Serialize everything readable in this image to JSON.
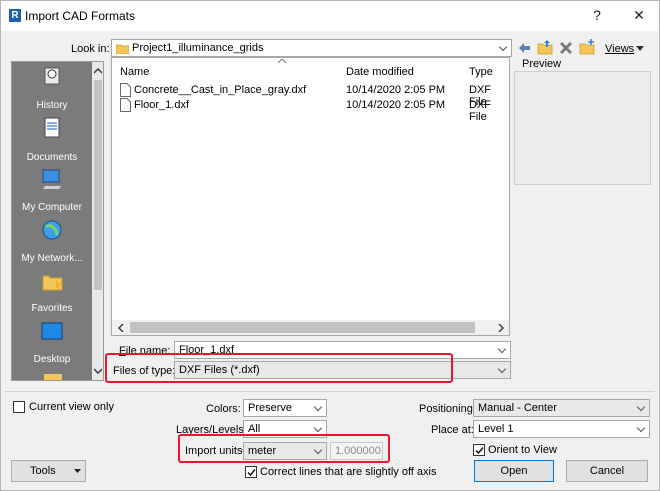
{
  "window": {
    "title": "Import CAD Formats",
    "help_label": "?",
    "close_label": "✕"
  },
  "look_in": {
    "label": "Look in:",
    "value": "Project1_illuminance_grids",
    "views_label": "Views"
  },
  "preview": {
    "label": "Preview"
  },
  "sidebar": {
    "items": [
      {
        "label": "History"
      },
      {
        "label": "Documents"
      },
      {
        "label": "My Computer"
      },
      {
        "label": "My Network..."
      },
      {
        "label": "Favorites"
      },
      {
        "label": "Desktop"
      }
    ]
  },
  "file_list": {
    "columns": [
      "Name",
      "Date modified",
      "Type"
    ],
    "rows": [
      {
        "name": "Concrete__Cast_in_Place_gray.dxf",
        "date": "10/14/2020 2:05 PM",
        "type": "DXF File"
      },
      {
        "name": "Floor_1.dxf",
        "date": "10/14/2020 2:05 PM",
        "type": "DXF File"
      }
    ]
  },
  "file_name": {
    "label": "File name:",
    "value": "Floor_1.dxf"
  },
  "files_of_type": {
    "label": "Files of type:",
    "value": "DXF Files  (*.dxf)"
  },
  "options": {
    "current_view_only": "Current view only",
    "colors_label": "Colors:",
    "colors_value": "Preserve",
    "layers_label": "Layers/Levels:",
    "layers_value": "All",
    "units_label": "Import units:",
    "units_value": "meter",
    "units_scale": "1.000000",
    "correct_lines": "Correct lines that are slightly off axis",
    "positioning_label": "Positioning:",
    "positioning_value": "Manual - Center",
    "place_at_label": "Place at:",
    "place_at_value": "Level 1",
    "orient_label": "Orient to View"
  },
  "buttons": {
    "tools": "Tools",
    "open": "Open",
    "cancel": "Cancel"
  },
  "colors": {
    "highlight": "#e8182c",
    "sidebar": "#7b7b7b"
  }
}
